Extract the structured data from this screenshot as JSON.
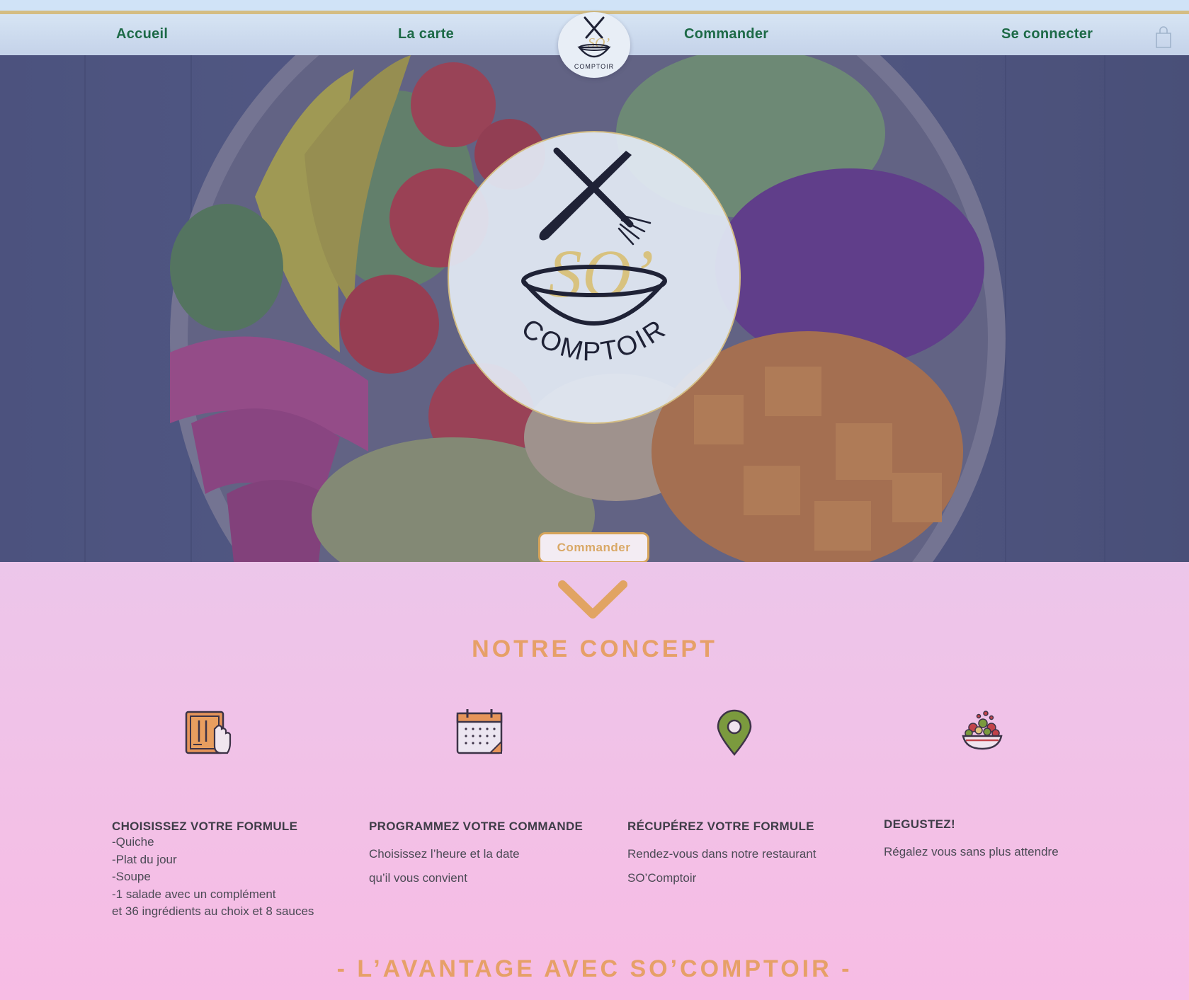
{
  "nav": {
    "items": [
      "Accueil",
      "La carte",
      "Commander",
      "Se connecter"
    ],
    "cart_icon": "shopping-bag-icon"
  },
  "logo": {
    "top_text": "SO’",
    "bottom_text": "COMPTOIR"
  },
  "hero": {
    "cta_label": "Commander",
    "background": "salad-bowl-photo"
  },
  "concept": {
    "title": "NOTRE  CONCEPT",
    "scroll_icon": "chevron-down-icon",
    "features": [
      {
        "icon": "menu-tablet-icon",
        "title": "CHOISISSEZ VOTRE FORMULE",
        "lines": [
          "-Quiche",
          "-Plat du jour",
          "-Soupe",
          "-1 salade avec un complément",
          "et 36 ingrédients au choix et 8 sauces"
        ]
      },
      {
        "icon": "calendar-icon",
        "title": "PROGRAMMEZ VOTRE COMMANDE",
        "lines": [
          "Choisissez l’heure et la date",
          "qu’il vous convient"
        ]
      },
      {
        "icon": "location-pin-icon",
        "title": "RÉCUPÉREZ VOTRE FORMULE",
        "lines": [
          "Rendez-vous dans notre restaurant",
          "SO’Comptoir"
        ]
      },
      {
        "icon": "salad-bowl-icon",
        "title": "DEGUSTEZ!",
        "lines": [
          "Régalez vous sans plus attendre"
        ]
      }
    ]
  },
  "advantage": {
    "title": "- L’AVANTAGE AVEC SO’COMPTOIR -"
  },
  "colors": {
    "nav_text": "#1d6a47",
    "accent_orange": "#e6a068",
    "gold": "#d4bd83",
    "text_dark": "#4b4a55"
  }
}
